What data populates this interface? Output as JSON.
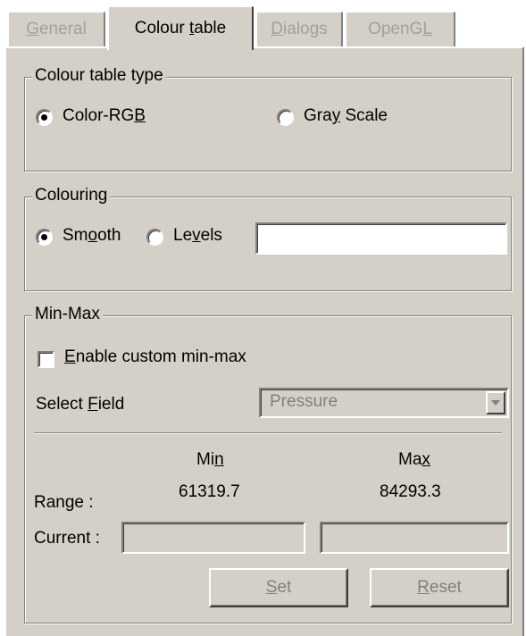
{
  "tabs": [
    {
      "label": "General",
      "mn": "G",
      "rest": "eneral",
      "active": false,
      "enabled": false
    },
    {
      "label": "Colour table",
      "pre": "Colour ",
      "mn": "t",
      "rest": "able",
      "active": true,
      "enabled": true
    },
    {
      "label": "Dialogs",
      "mn": "D",
      "rest": "ialogs",
      "active": false,
      "enabled": false
    },
    {
      "label": "OpenGL",
      "pre": "OpenG",
      "mn": "L",
      "active": false,
      "enabled": false
    }
  ],
  "colour_table_type": {
    "legend": "Colour table type",
    "options": [
      {
        "label": "Color-RGB",
        "pre": "Color-RG",
        "mn": "B",
        "rest": "",
        "checked": true
      },
      {
        "label": "Gray Scale",
        "pre": "Gra",
        "mn": "y",
        "rest": " Scale",
        "checked": false
      }
    ]
  },
  "colouring": {
    "legend": "Colouring",
    "options": [
      {
        "label": "Smooth",
        "pre": "Sm",
        "mn": "o",
        "rest": "oth",
        "checked": true
      },
      {
        "label": "Levels",
        "pre": "Le",
        "mn": "v",
        "rest": "els",
        "checked": false
      }
    ],
    "levels_value": ""
  },
  "minmax": {
    "legend": "Min-Max",
    "enable_label": {
      "mn": "E",
      "rest": "nable custom min-max"
    },
    "enable_checked": false,
    "select_field": {
      "pre": "Select ",
      "mn": "F",
      "rest": "ield"
    },
    "field_value": "Pressure",
    "min_header": {
      "pre": "Mi",
      "mn": "n"
    },
    "max_header": {
      "pre": "Ma",
      "mn": "x"
    },
    "range_label": "Range :",
    "current_label": "Current :",
    "range_min": "61319.7",
    "range_max": "84293.3",
    "current_min": "",
    "current_max": "",
    "set_button": {
      "mn": "S",
      "rest": "et"
    },
    "reset_button": {
      "mn": "R",
      "rest": "eset"
    }
  }
}
